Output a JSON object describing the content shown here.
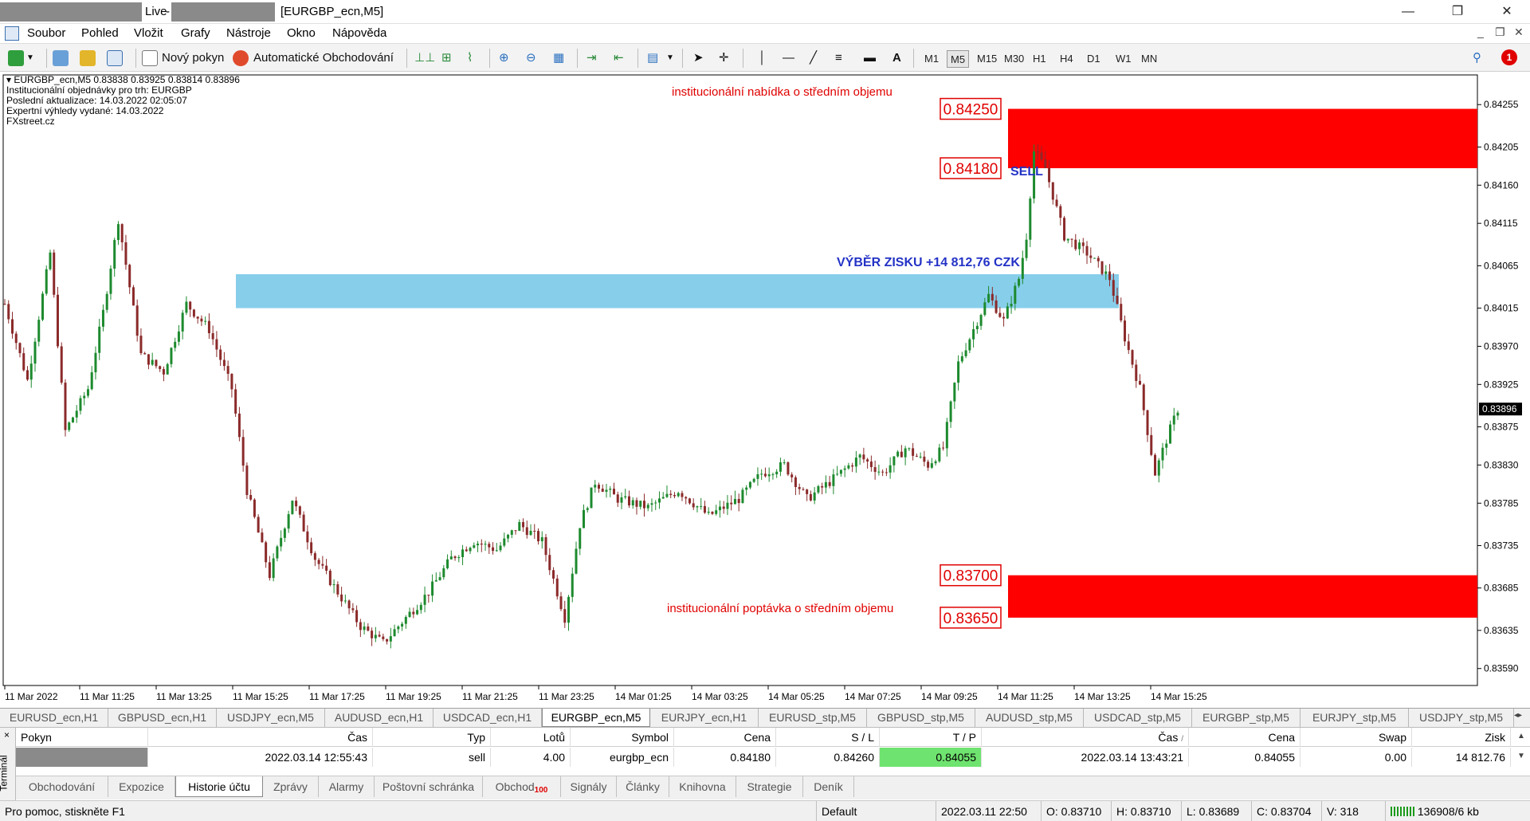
{
  "window": {
    "live": "Live",
    "dash": "-",
    "title": "[EURGBP_ecn,M5]",
    "controls": [
      "—",
      "❐",
      "✕"
    ]
  },
  "menu": [
    "Soubor",
    "Pohled",
    "Vložit",
    "Grafy",
    "Nástroje",
    "Okno",
    "Nápověda"
  ],
  "menu_right": [
    "_",
    "❐",
    "✕"
  ],
  "toolbar": {
    "new_order": "Nový pokyn",
    "auto_trading": "Automatické Obchodování",
    "timeframes": [
      "M1",
      "M5",
      "M15",
      "M30",
      "H1",
      "H4",
      "D1",
      "W1",
      "MN"
    ],
    "active_timeframe": "M5",
    "text_tool": "A",
    "alert_count": "1"
  },
  "chart": {
    "info_lines": [
      "EURGBP_ecn,M5  0.83838 0.83925 0.83814 0.83896",
      "Institucionální objednávky pro trh: EURGBP",
      "Poslední aktualizace: 14.03.2022 02:05:07",
      "Expertní výhledy vydané: 14.03.2022",
      "FXstreet.cz"
    ],
    "supply_label": "institucionální nabídka o středním objemu",
    "demand_label": "institucionální poptávka o středním objemu",
    "sell_label": "SELL",
    "profit_label": "VÝBĚR ZISKU +14 812,76 CZK",
    "supply_high": "0.84250",
    "supply_low": "0.84180",
    "demand_high": "0.83700",
    "demand_low": "0.83650",
    "current_price": "0.83896",
    "colors": {
      "zone": "#ff0000",
      "profit_zone": "#87ceeb",
      "bull": "#1d8a2e",
      "bear": "#8b2a2a"
    }
  },
  "chart_data": {
    "type": "candlestick",
    "symbol": "EURGBP_ecn",
    "timeframe": "M5",
    "ylim": [
      0.8357,
      0.8429
    ],
    "y_ticks": [
      "0.84255",
      "0.84205",
      "0.84160",
      "0.84115",
      "0.84065",
      "0.84015",
      "0.83970",
      "0.83925",
      "0.83875",
      "0.83830",
      "0.83785",
      "0.83735",
      "0.83685",
      "0.83635",
      "0.83590"
    ],
    "x_ticks": [
      "11 Mar 2022",
      "11 Mar 11:25",
      "11 Mar 13:25",
      "11 Mar 15:25",
      "11 Mar 17:25",
      "11 Mar 19:25",
      "11 Mar 21:25",
      "11 Mar 23:25",
      "14 Mar 01:25",
      "14 Mar 03:25",
      "14 Mar 05:25",
      "14 Mar 07:25",
      "14 Mar 09:25",
      "14 Mar 11:25",
      "14 Mar 13:25",
      "14 Mar 15:25"
    ],
    "anchors": [
      [
        0,
        0.8402
      ],
      [
        6,
        0.8393
      ],
      [
        12,
        0.8408
      ],
      [
        16,
        0.8387
      ],
      [
        22,
        0.8392
      ],
      [
        26,
        0.8401
      ],
      [
        30,
        0.8412
      ],
      [
        36,
        0.8396
      ],
      [
        42,
        0.8394
      ],
      [
        48,
        0.8402
      ],
      [
        54,
        0.8399
      ],
      [
        60,
        0.8392
      ],
      [
        64,
        0.838
      ],
      [
        70,
        0.837
      ],
      [
        76,
        0.8379
      ],
      [
        82,
        0.8372
      ],
      [
        88,
        0.8368
      ],
      [
        94,
        0.8364
      ],
      [
        100,
        0.8362
      ],
      [
        106,
        0.8365
      ],
      [
        112,
        0.8368
      ],
      [
        118,
        0.8372
      ],
      [
        124,
        0.8374
      ],
      [
        130,
        0.8373
      ],
      [
        136,
        0.8376
      ],
      [
        142,
        0.8374
      ],
      [
        148,
        0.8365
      ],
      [
        152,
        0.8376
      ],
      [
        156,
        0.8381
      ],
      [
        162,
        0.8379
      ],
      [
        170,
        0.8378
      ],
      [
        178,
        0.838
      ],
      [
        186,
        0.8377
      ],
      [
        194,
        0.8379
      ],
      [
        200,
        0.8382
      ],
      [
        206,
        0.8383
      ],
      [
        212,
        0.8379
      ],
      [
        218,
        0.8381
      ],
      [
        226,
        0.8384
      ],
      [
        232,
        0.8382
      ],
      [
        238,
        0.8385
      ],
      [
        244,
        0.8383
      ],
      [
        248,
        0.8385
      ],
      [
        252,
        0.8395
      ],
      [
        256,
        0.8399
      ],
      [
        260,
        0.8403
      ],
      [
        264,
        0.84
      ],
      [
        268,
        0.8405
      ],
      [
        270,
        0.841
      ],
      [
        272,
        0.842
      ],
      [
        275,
        0.8418
      ],
      [
        280,
        0.841
      ],
      [
        286,
        0.8408
      ],
      [
        292,
        0.8405
      ],
      [
        296,
        0.8398
      ],
      [
        300,
        0.8392
      ],
      [
        304,
        0.8382
      ],
      [
        307,
        0.8386
      ],
      [
        310,
        0.83896
      ]
    ],
    "zones": [
      {
        "name": "supply",
        "high": 0.8425,
        "low": 0.8418,
        "color": "#ff0000"
      },
      {
        "name": "demand",
        "high": 0.837,
        "low": 0.8365,
        "color": "#ff0000"
      },
      {
        "name": "profit",
        "high": 0.84055,
        "low": 0.84015,
        "color": "#87ceeb"
      }
    ]
  },
  "symbol_tabs": [
    "EURUSD_ecn,H1",
    "GBPUSD_ecn,H1",
    "USDJPY_ecn,M5",
    "AUDUSD_ecn,H1",
    "USDCAD_ecn,H1",
    "EURGBP_ecn,M5",
    "EURJPY_ecn,H1",
    "EURUSD_stp,M5",
    "GBPUSD_stp,M5",
    "AUDUSD_stp,M5",
    "USDCAD_stp,M5",
    "EURGBP_stp,M5",
    "EURJPY_stp,M5",
    "USDJPY_stp,M5"
  ],
  "active_symbol_tab": "EURGBP_ecn,M5",
  "terminal": {
    "side_label": "Terminál",
    "close": "×",
    "headers": [
      "Pokyn",
      "Čas",
      "Typ",
      "Lotů",
      "Symbol",
      "Cena",
      "S / L",
      "T / P",
      "Čas",
      "Cena",
      "Swap",
      "Zisk"
    ],
    "sort_mark": "/",
    "row": {
      "time_open": "2022.03.14 12:55:43",
      "type": "sell",
      "lots": "4.00",
      "symbol": "eurgbp_ecn",
      "price_open": "0.84180",
      "sl": "0.84260",
      "tp": "0.84055",
      "time_close": "2022.03.14 13:43:21",
      "price_close": "0.84055",
      "swap": "0.00",
      "profit": "14 812.76"
    },
    "tabs": [
      "Obchodování",
      "Expozice",
      "Historie účtu",
      "Zprávy",
      "Alarmy",
      "Poštovní schránka",
      "Obchod",
      "Signály",
      "Články",
      "Knihovna",
      "Strategie",
      "Deník"
    ],
    "active_tab": "Historie účtu",
    "trade_badge": "100"
  },
  "status": {
    "help": "Pro pomoc, stiskněte F1",
    "profile": "Default",
    "datetime": "2022.03.11 22:50",
    "open": "O: 0.83710",
    "high": "H: 0.83710",
    "low": "L: 0.83689",
    "close": "C: 0.83704",
    "volume": "V: 318",
    "traffic": "136908/6 kb"
  }
}
